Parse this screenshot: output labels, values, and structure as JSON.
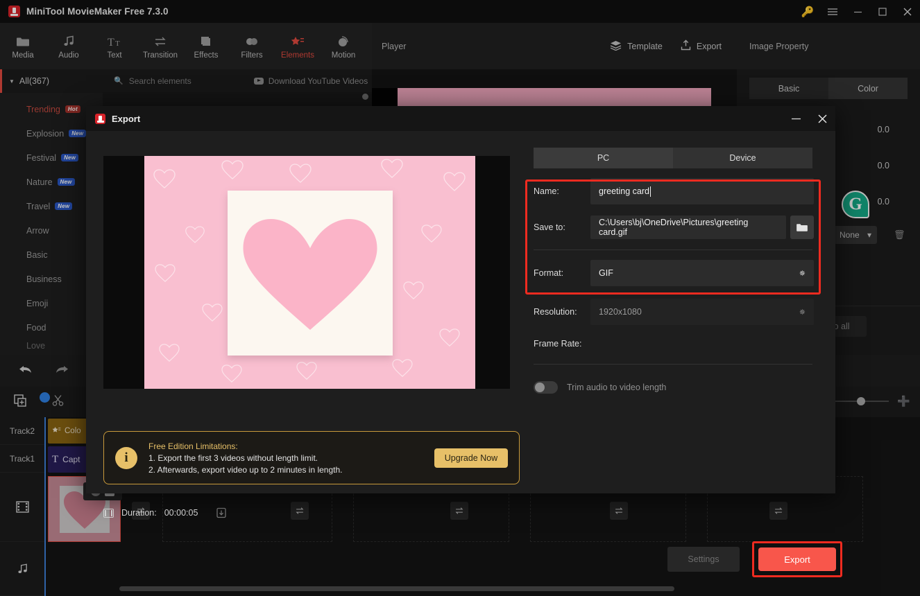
{
  "window": {
    "title": "MiniTool MovieMaker Free 7.3.0",
    "controls": {
      "key": "key-icon",
      "menu": "menu-icon",
      "minimize": "–",
      "maximize": "▭",
      "close": "✕"
    }
  },
  "toolbar": {
    "items": [
      {
        "label": "Media",
        "icon": "folder-icon"
      },
      {
        "label": "Audio",
        "icon": "music-note-icon"
      },
      {
        "label": "Text",
        "icon": "text-icon"
      },
      {
        "label": "Transition",
        "icon": "transition-arrows-icon"
      },
      {
        "label": "Effects",
        "icon": "effects-squares-icon"
      },
      {
        "label": "Filters",
        "icon": "filters-drops-icon"
      },
      {
        "label": "Elements",
        "icon": "elements-star-icon",
        "active": true
      },
      {
        "label": "Motion",
        "icon": "motion-circle-icon"
      }
    ],
    "accent": "#e04a3f"
  },
  "sidebar": {
    "all_label": "All(367)",
    "items": [
      {
        "label": "Trending",
        "badge": "Hot",
        "badge_type": "hot"
      },
      {
        "label": "Explosion",
        "badge": "New",
        "badge_type": "new"
      },
      {
        "label": "Festival",
        "badge": "New",
        "badge_type": "new"
      },
      {
        "label": "Nature",
        "badge": "New",
        "badge_type": "new"
      },
      {
        "label": "Travel",
        "badge": "New",
        "badge_type": "new"
      },
      {
        "label": "Arrow",
        "badge": "",
        "badge_type": ""
      },
      {
        "label": "Basic",
        "badge": "",
        "badge_type": ""
      },
      {
        "label": "Business",
        "badge": "",
        "badge_type": ""
      },
      {
        "label": "Emoji",
        "badge": "",
        "badge_type": ""
      },
      {
        "label": "Food",
        "badge": "",
        "badge_type": ""
      },
      {
        "label": "Love",
        "badge": "",
        "badge_type": ""
      }
    ]
  },
  "elements_bar": {
    "search_placeholder": "Search elements",
    "youtube_label": "Download YouTube Videos"
  },
  "player": {
    "label": "Player",
    "template_label": "Template",
    "export_label": "Export"
  },
  "properties": {
    "title": "Image Property",
    "tabs": [
      {
        "label": "Basic",
        "active": false
      },
      {
        "label": "Color",
        "active": true
      }
    ],
    "rows": [
      {
        "value": "0.0"
      },
      {
        "value": "0.0"
      },
      {
        "value": "0.0"
      }
    ],
    "select_value": "None",
    "apply_label": "Apply to all",
    "delete_icon": "trash-icon",
    "grammarly_icon": "grammarly-g-icon"
  },
  "timeline": {
    "tracks": [
      {
        "label": "Track2"
      },
      {
        "label": "Track1"
      }
    ],
    "clips": [
      {
        "label": "Colo",
        "icon": "elements-star-icon",
        "type": "element"
      },
      {
        "label": "Capt",
        "icon": "text-icon",
        "type": "caption"
      }
    ],
    "transition_icon": "transition-arrows-icon",
    "download_icon": "download-box-icon",
    "undo_icon": "undo-arrow-icon",
    "redo_icon": "redo-arrow-icon",
    "split_icon": "split-icon",
    "add_media_icon": "add-media-icon",
    "video_track_icon": "film-strip-icon",
    "audio_track_icon": "music-note-icon",
    "zoom_plus_icon": "zoom-in-icon"
  },
  "export_dialog": {
    "title": "Export",
    "minimize": "–",
    "close": "✕",
    "target_tabs": [
      {
        "label": "PC",
        "active": true
      },
      {
        "label": "Device",
        "active": false
      }
    ],
    "fields": {
      "name_label": "Name:",
      "name_value": "greeting card",
      "saveto_label": "Save to:",
      "saveto_value": "C:\\Users\\bj\\OneDrive\\Pictures\\greeting card.gif",
      "folder_icon": "folder-browse-icon",
      "format_label": "Format:",
      "format_value": "GIF",
      "resolution_label": "Resolution:",
      "resolution_value": "1920x1080",
      "framerate_label": "Frame Rate:",
      "framerate_value": "",
      "trim_label": "Trim audio to video length",
      "trim_on": false
    },
    "duration_label": "Duration:",
    "duration_value": "00:00:05",
    "notice": {
      "title": "Free Edition Limitations:",
      "line1": "1. Export the first 3 videos without length limit.",
      "line2": "2. Afterwards, export video up to 2 minutes in length.",
      "upgrade_label": "Upgrade Now"
    },
    "settings_label": "Settings",
    "export_label": "Export",
    "highlight_color": "#ee2b20",
    "export_button_color": "#f8564b"
  }
}
